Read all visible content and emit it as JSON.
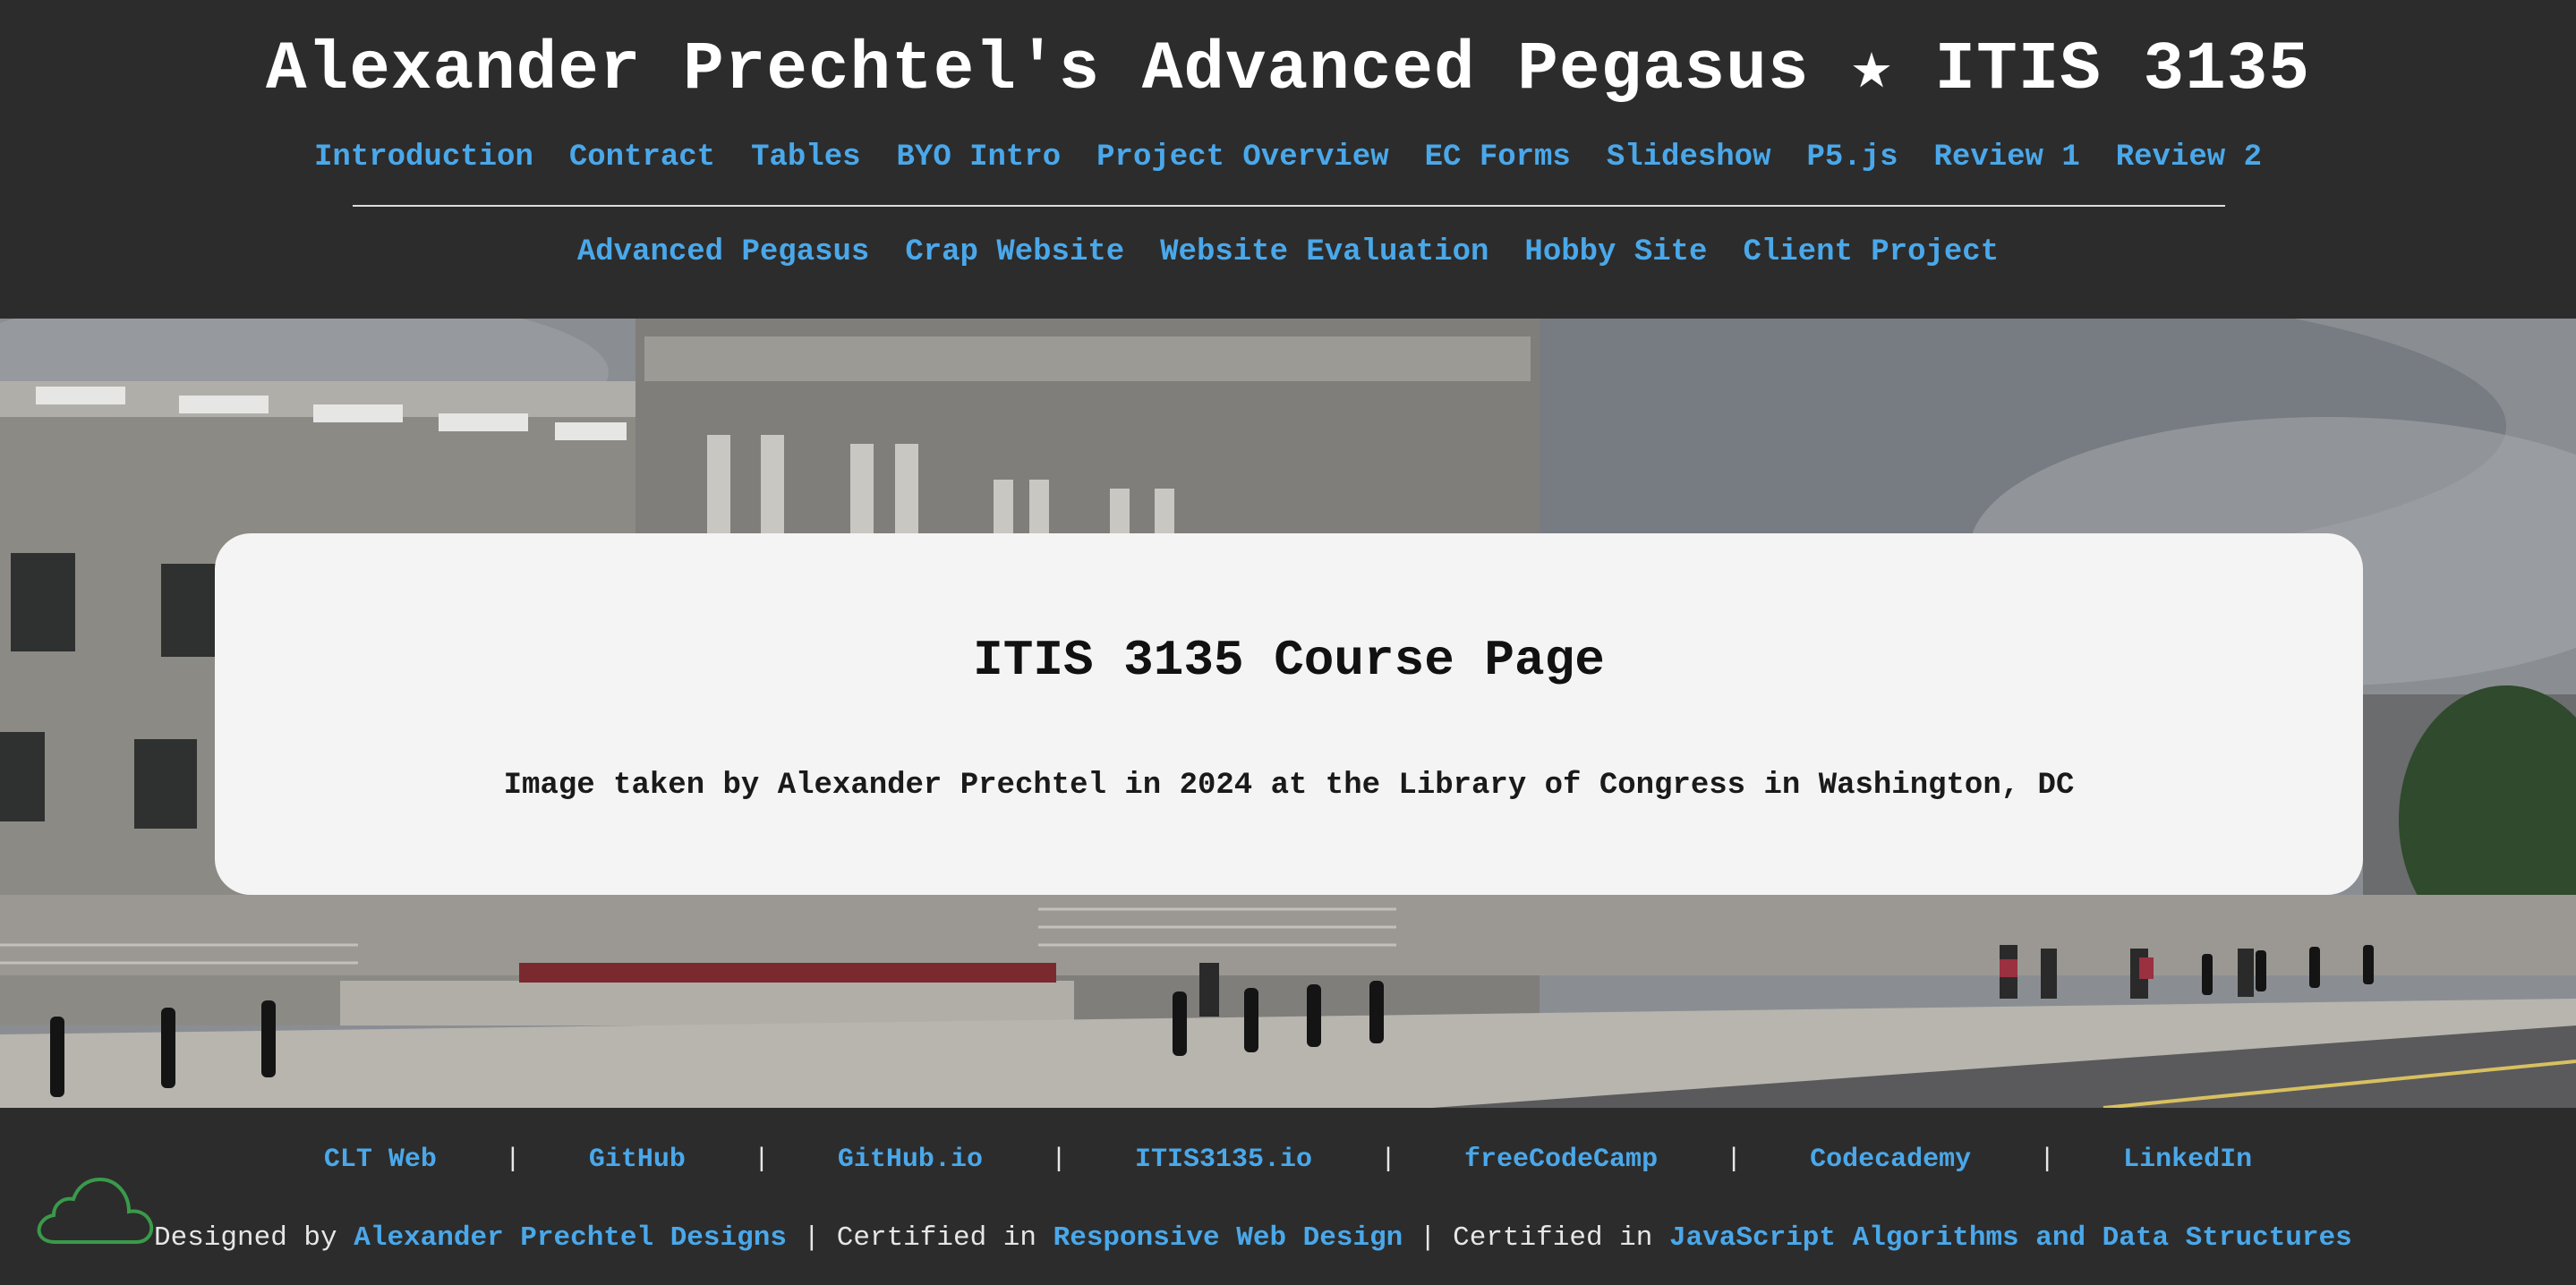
{
  "header": {
    "title": "Alexander Prechtel's Advanced Pegasus ★ ITIS 3135",
    "nav_row1": [
      "Introduction",
      "Contract",
      "Tables",
      "BYO Intro",
      "Project Overview",
      "EC Forms",
      "Slideshow",
      "P5.js",
      "Review 1",
      "Review 2"
    ],
    "nav_row2": [
      "Advanced Pegasus",
      "Crap Website",
      "Website Evaluation",
      "Hobby Site",
      "Client Project"
    ]
  },
  "hero": {
    "card_title": "ITIS 3135 Course Page",
    "card_caption": "Image taken by Alexander Prechtel in 2024 at the Library of Congress in Washington, DC"
  },
  "footer": {
    "links": [
      "CLT Web",
      "GitHub",
      "GitHub.io",
      "ITIS3135.io",
      "freeCodeCamp",
      "Codecademy",
      "LinkedIn"
    ],
    "separator": "|",
    "credits": {
      "designed_by": "Designed by",
      "designer": "Alexander Prechtel Designs",
      "pipe": "|",
      "certified_in": "Certified in",
      "cert1": "Responsive Web Design",
      "cert2": "JavaScript Algorithms and Data Structures"
    },
    "logo_icon": "cloud-icon"
  },
  "colors": {
    "background": "#2c2c2c",
    "link": "#4aa8ea",
    "title": "#ffffff",
    "card": "#f4f4f4",
    "logo": "#3a9a4a"
  }
}
